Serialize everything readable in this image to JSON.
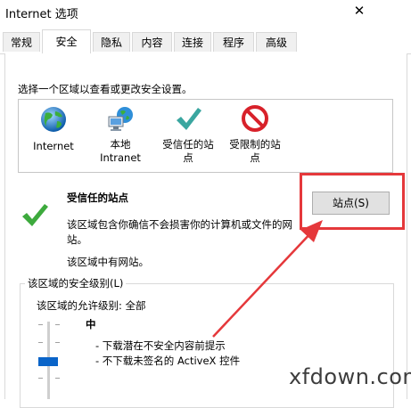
{
  "window": {
    "title": "Internet 选项",
    "close_glyph": "✕"
  },
  "tabs": [
    {
      "label": "常规"
    },
    {
      "label": "安全"
    },
    {
      "label": "隐私"
    },
    {
      "label": "内容"
    },
    {
      "label": "连接"
    },
    {
      "label": "程序"
    },
    {
      "label": "高级"
    }
  ],
  "active_tab": "安全",
  "security": {
    "instruction": "选择一个区域以查看或更改安全设置。",
    "zones": [
      {
        "line1": "Internet",
        "line2": "",
        "icon": "globe-icon"
      },
      {
        "line1": "本地",
        "line2": "Intranet",
        "icon": "intranet-icon"
      },
      {
        "line1": "受信任的站",
        "line2": "点",
        "icon": "checkmark-icon",
        "selected": true
      },
      {
        "line1": "受限制的站",
        "line2": "点",
        "icon": "prohibited-icon"
      }
    ],
    "zone_title": "受信任的站点",
    "zone_desc_line1": "该区域包含你确信不会损害你的计算机或文件的网",
    "zone_desc_line2": "站。",
    "zone_has_sites": "该区域中有网站。",
    "sites_button": "站点(S)",
    "level_group_title": "该区域的安全级别(L)",
    "allowed_levels": "该区域的允许级别: 全部",
    "level_name": "中",
    "level_bullets": [
      "- 下载潜在不安全内容前提示",
      "- 不下载未签名的 ActiveX 控件"
    ]
  },
  "watermark": "xfdown.com",
  "colors": {
    "selection": "#3399ff",
    "annotation_red": "#e5383b",
    "slider_thumb": "#0a64c8"
  }
}
